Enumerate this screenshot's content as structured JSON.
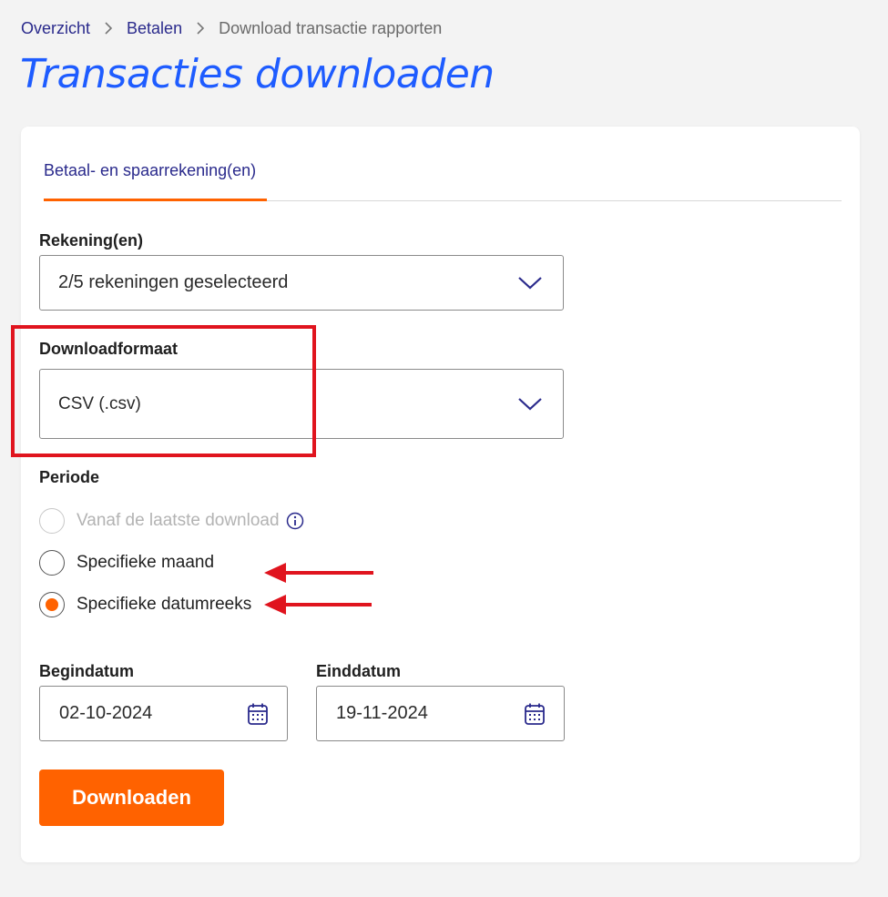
{
  "breadcrumb": {
    "items": [
      "Overzicht",
      "Betalen"
    ],
    "current": "Download transactie rapporten"
  },
  "page_title": "Transacties downloaden",
  "tabs": [
    {
      "label": "Betaal- en spaarrekening(en)",
      "active": true
    }
  ],
  "form": {
    "accounts": {
      "label": "Rekening(en)",
      "value": "2/5 rekeningen geselecteerd"
    },
    "format": {
      "label": "Downloadformaat",
      "value": "CSV (.csv)"
    },
    "period": {
      "label": "Periode",
      "options": [
        {
          "label": "Vanaf de laatste download",
          "disabled": true,
          "selected": false
        },
        {
          "label": "Specifieke maand",
          "disabled": false,
          "selected": false
        },
        {
          "label": "Specifieke datumreeks",
          "disabled": false,
          "selected": true
        }
      ]
    },
    "start_date": {
      "label": "Begindatum",
      "value": "02-10-2024"
    },
    "end_date": {
      "label": "Einddatum",
      "value": "19-11-2024"
    },
    "submit_label": "Downloaden"
  },
  "colors": {
    "accent": "#ff6200",
    "title_blue": "#1e5cff",
    "nav_blue": "#2a2a8c",
    "annotation_red": "#e0141e",
    "background": "#f3f3f3"
  },
  "icons": [
    "chevron-right-icon",
    "chevron-down-icon",
    "info-icon",
    "calendar-icon",
    "arrow-left-icon"
  ]
}
